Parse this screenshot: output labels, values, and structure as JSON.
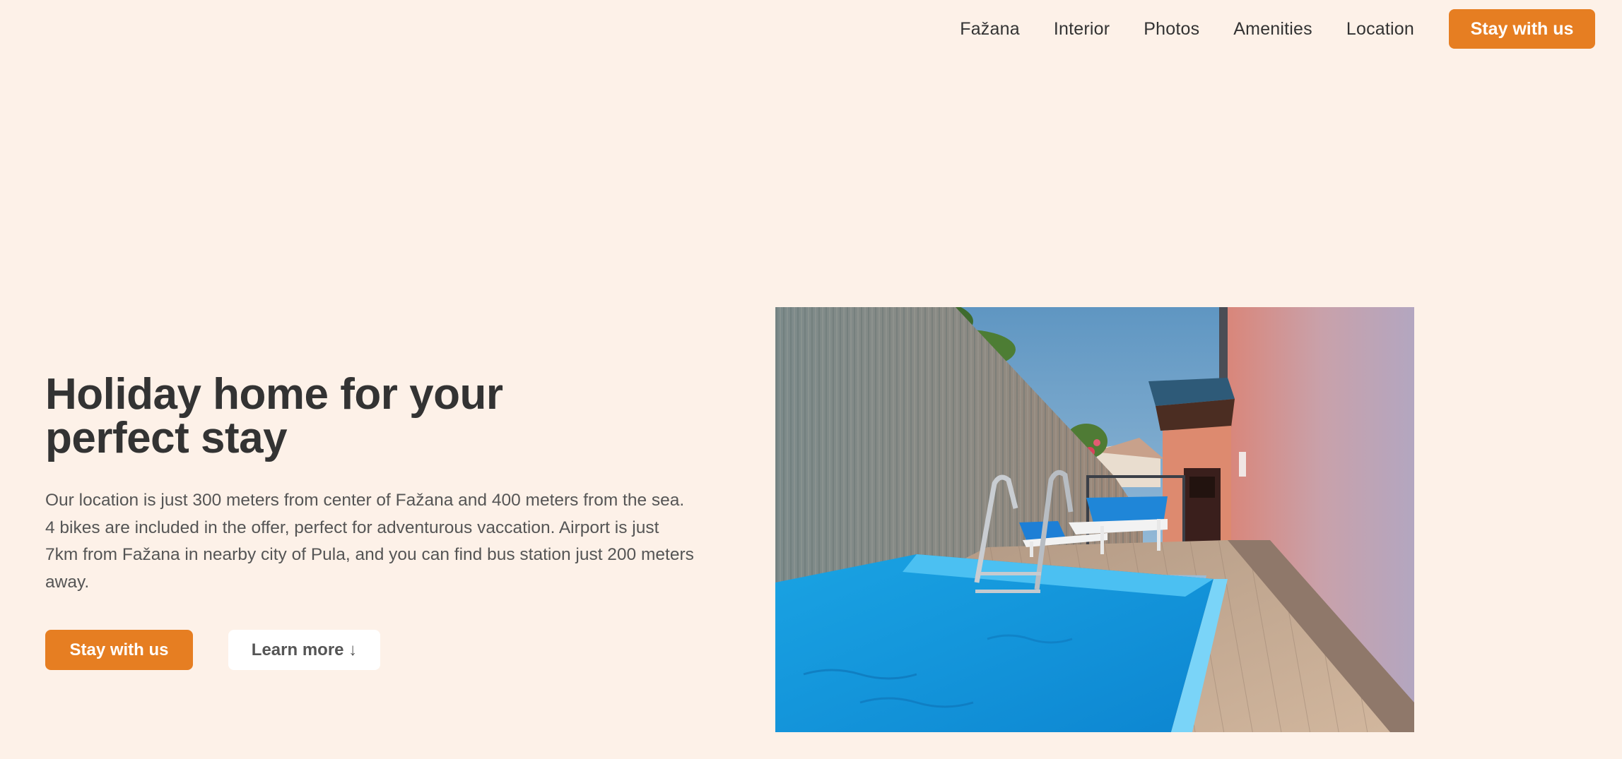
{
  "nav": {
    "links": [
      "Fažana",
      "Interior",
      "Photos",
      "Amenities",
      "Location"
    ],
    "cta_label": "Stay with us"
  },
  "hero": {
    "title": "Holiday home for your perfect stay",
    "description": "Our location is just 300 meters from center of Fažana and 400 meters from the sea. 4 bikes are included in the offer, perfect for adventurous vaccation. Airport is just 7km from Fažana in nearby city of Pula, and you can find bus station just 200 meters away.",
    "primary_button": "Stay with us",
    "secondary_button": "Learn more ↓"
  },
  "colors": {
    "background": "#fdf1e8",
    "accent": "#e67e22",
    "text": "#333333"
  }
}
